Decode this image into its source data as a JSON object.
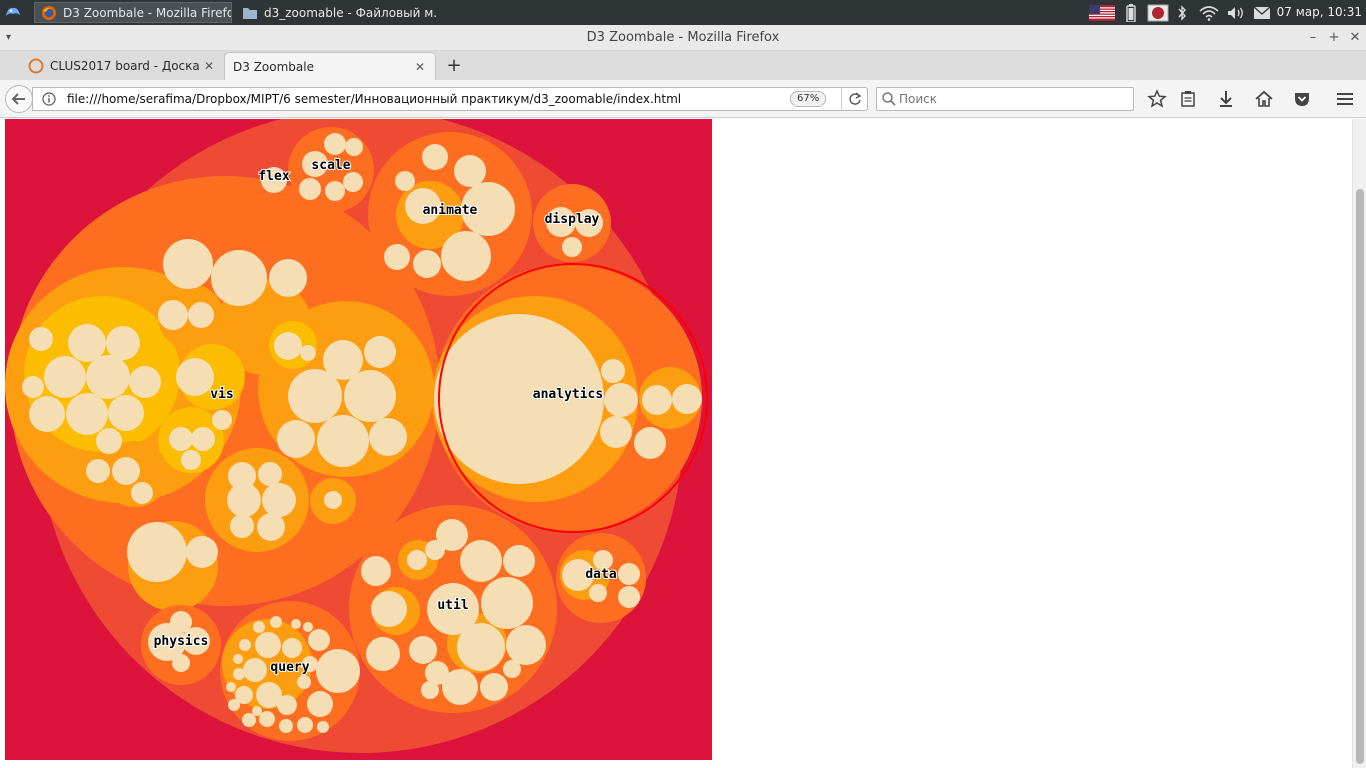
{
  "system_panel": {
    "taskbar": [
      {
        "title": "D3 Zoombale - Mozilla Firefox",
        "active": true
      },
      {
        "title": "d3_zoomable - Файловый м...",
        "active": false
      }
    ],
    "clock": "07 мар, 10:31"
  },
  "window": {
    "title": "D3 Zoombale - Mozilla Firefox"
  },
  "tabs": [
    {
      "title": "CLUS2017 board - Доска ...",
      "active": false
    },
    {
      "title": "D3 Zoombale",
      "active": true
    }
  ],
  "navbar": {
    "url": "file:///home/serafima/Dropbox/MIPT/6 semester/Инновационный практикум/d3_zoomable/index.html",
    "zoom": "67%",
    "search_placeholder": "Поиск"
  },
  "visualization": {
    "colors": {
      "background": "#dc143c",
      "root": "#ef4a33",
      "depth1": "#fd6e20",
      "depth2": "#fd9d10",
      "depth3": "#fcbc00",
      "leaf": "#f5deb3",
      "focus_stroke": "#ff0000"
    },
    "labels": [
      "flex",
      "scale",
      "animate",
      "display",
      "vis",
      "analytics",
      "data",
      "util",
      "physics",
      "query"
    ]
  }
}
